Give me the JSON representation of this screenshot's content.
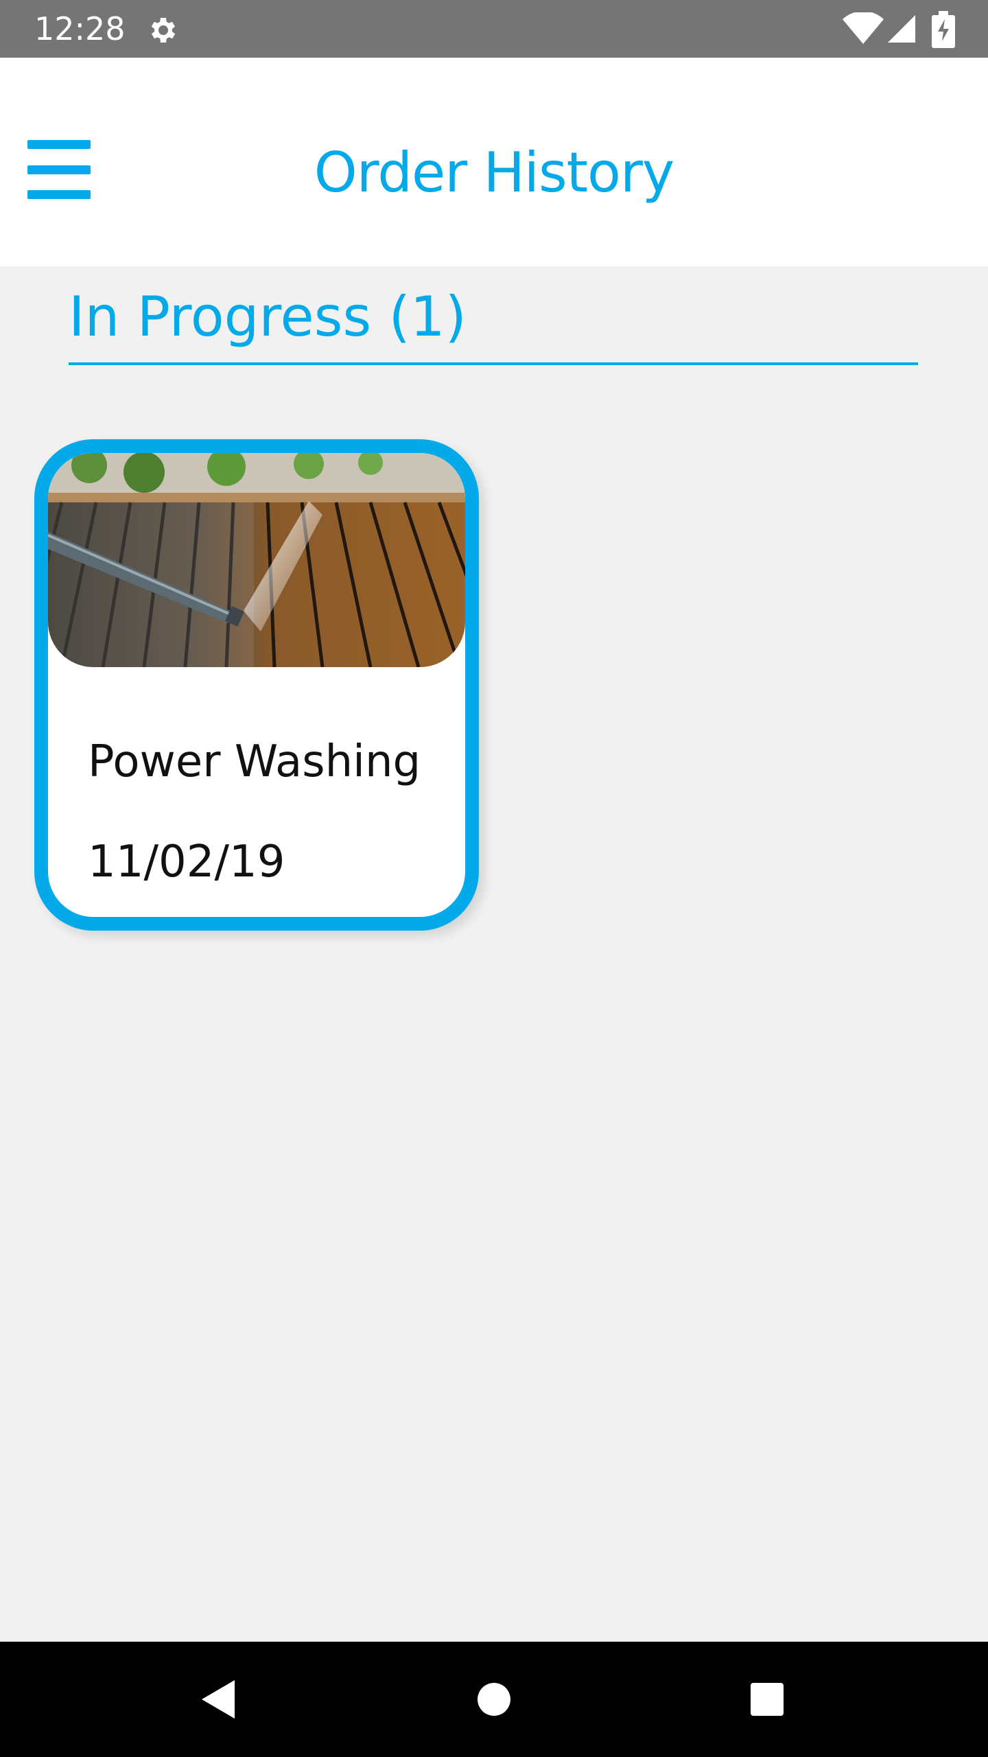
{
  "status_bar": {
    "time": "12:28",
    "icons": [
      "gear-icon",
      "wifi-icon",
      "cell-signal-icon",
      "battery-charging-icon"
    ]
  },
  "app_bar": {
    "title": "Order History",
    "menu_icon": "hamburger-menu-icon"
  },
  "section": {
    "label": "In Progress (1)"
  },
  "orders": [
    {
      "title": "Power Washing",
      "date": "11/02/19",
      "image": "pressure washer cleaning wooden deck"
    }
  ],
  "nav_bar": {
    "icons": [
      "back-icon",
      "home-icon",
      "recent-apps-icon"
    ]
  },
  "colors": {
    "accent": "#03a9e8",
    "status_bar": "#757575",
    "background": "#f1f1f1",
    "nav_bar": "#000000"
  }
}
